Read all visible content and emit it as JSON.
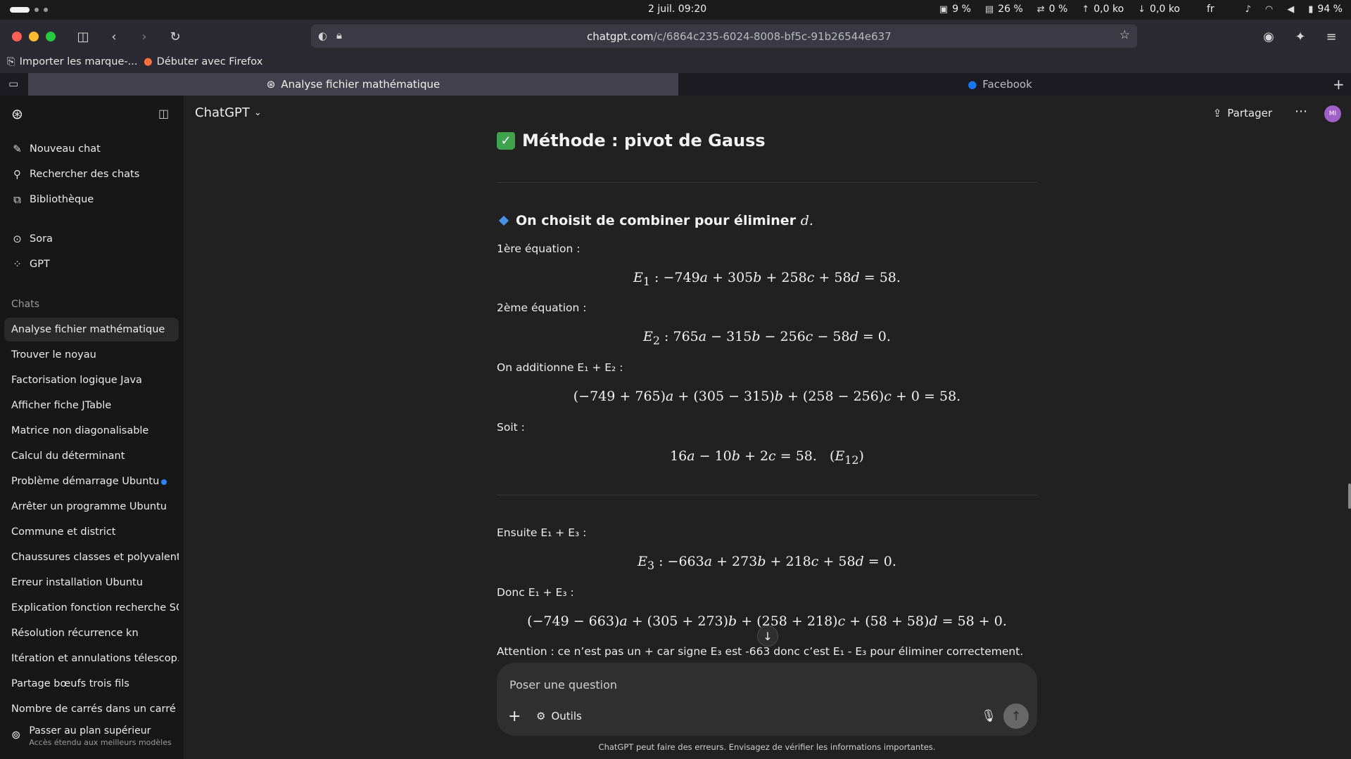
{
  "os_bar": {
    "clock": "2 juil.  09:20",
    "cpu": "9 %",
    "memory": "26 %",
    "swap": "0 %",
    "upload": "0,0 ko",
    "download": "0,0 ko",
    "lang": "fr",
    "battery": "94 %"
  },
  "browser": {
    "url_host": "chatgpt.com",
    "url_path": "/c/6864c235-6024-8008-bf5c-91b26544e637",
    "bookmarks": [
      {
        "label": "Importer les marque-..."
      },
      {
        "label": "Débuter avec Firefox"
      }
    ],
    "tabs": [
      {
        "label": "Analyse fichier mathématique",
        "active": true
      },
      {
        "label": "Facebook",
        "active": false
      }
    ]
  },
  "sidebar": {
    "nav": [
      {
        "label": "Nouveau chat",
        "icon": "edit-icon"
      },
      {
        "label": "Rechercher des chats",
        "icon": "search-icon"
      },
      {
        "label": "Bibliothèque",
        "icon": "library-icon"
      },
      {
        "label": "Sora",
        "icon": "play-icon"
      },
      {
        "label": "GPT",
        "icon": "grid-icon"
      }
    ],
    "chats_heading": "Chats",
    "chats": [
      "Analyse fichier mathématique",
      "Trouver le noyau",
      "Factorisation logique Java",
      "Afficher fiche JTable",
      "Matrice non diagonalisable",
      "Calcul du déterminant",
      "Problème démarrage Ubuntu",
      "Arrêter un programme Ubuntu",
      "Commune et district",
      "Chaussures classes et polyvalentes",
      "Erreur installation Ubuntu",
      "Explication fonction recherche SQL",
      "Résolution récurrence kn",
      "Itération et annulations télescop…",
      "Partage bœufs trois fils",
      "Nombre de carrés dans un carré"
    ],
    "upgrade_title": "Passer au plan supérieur",
    "upgrade_subtitle": "Accès étendu aux meilleurs modèles"
  },
  "header": {
    "model": "ChatGPT",
    "share": "Partager",
    "avatar": "MI"
  },
  "conversation": {
    "heading": "Méthode : pivot de Gauss",
    "subheading": "On choisit de combiner pour éliminer",
    "subheading_var": "d.",
    "eq1_label": "1ère équation :",
    "eq2_label": "2ème équation :",
    "add12_label": "On additionne E₁ + E₂ :",
    "soit_label": "Soit :",
    "then13_label": "Ensuite E₁ + E₃ :",
    "donc13_label": "Donc E₁ + E₃ :",
    "attention": "Attention : ce n’est pas un + car signe E₃ est -663 donc c’est E₁ - E₃ pour éliminer correctement."
  },
  "composer": {
    "placeholder": "Poser une question",
    "tools": "Outils",
    "disclaimer": "ChatGPT peut faire des erreurs. Envisagez de vérifier les informations importantes."
  }
}
